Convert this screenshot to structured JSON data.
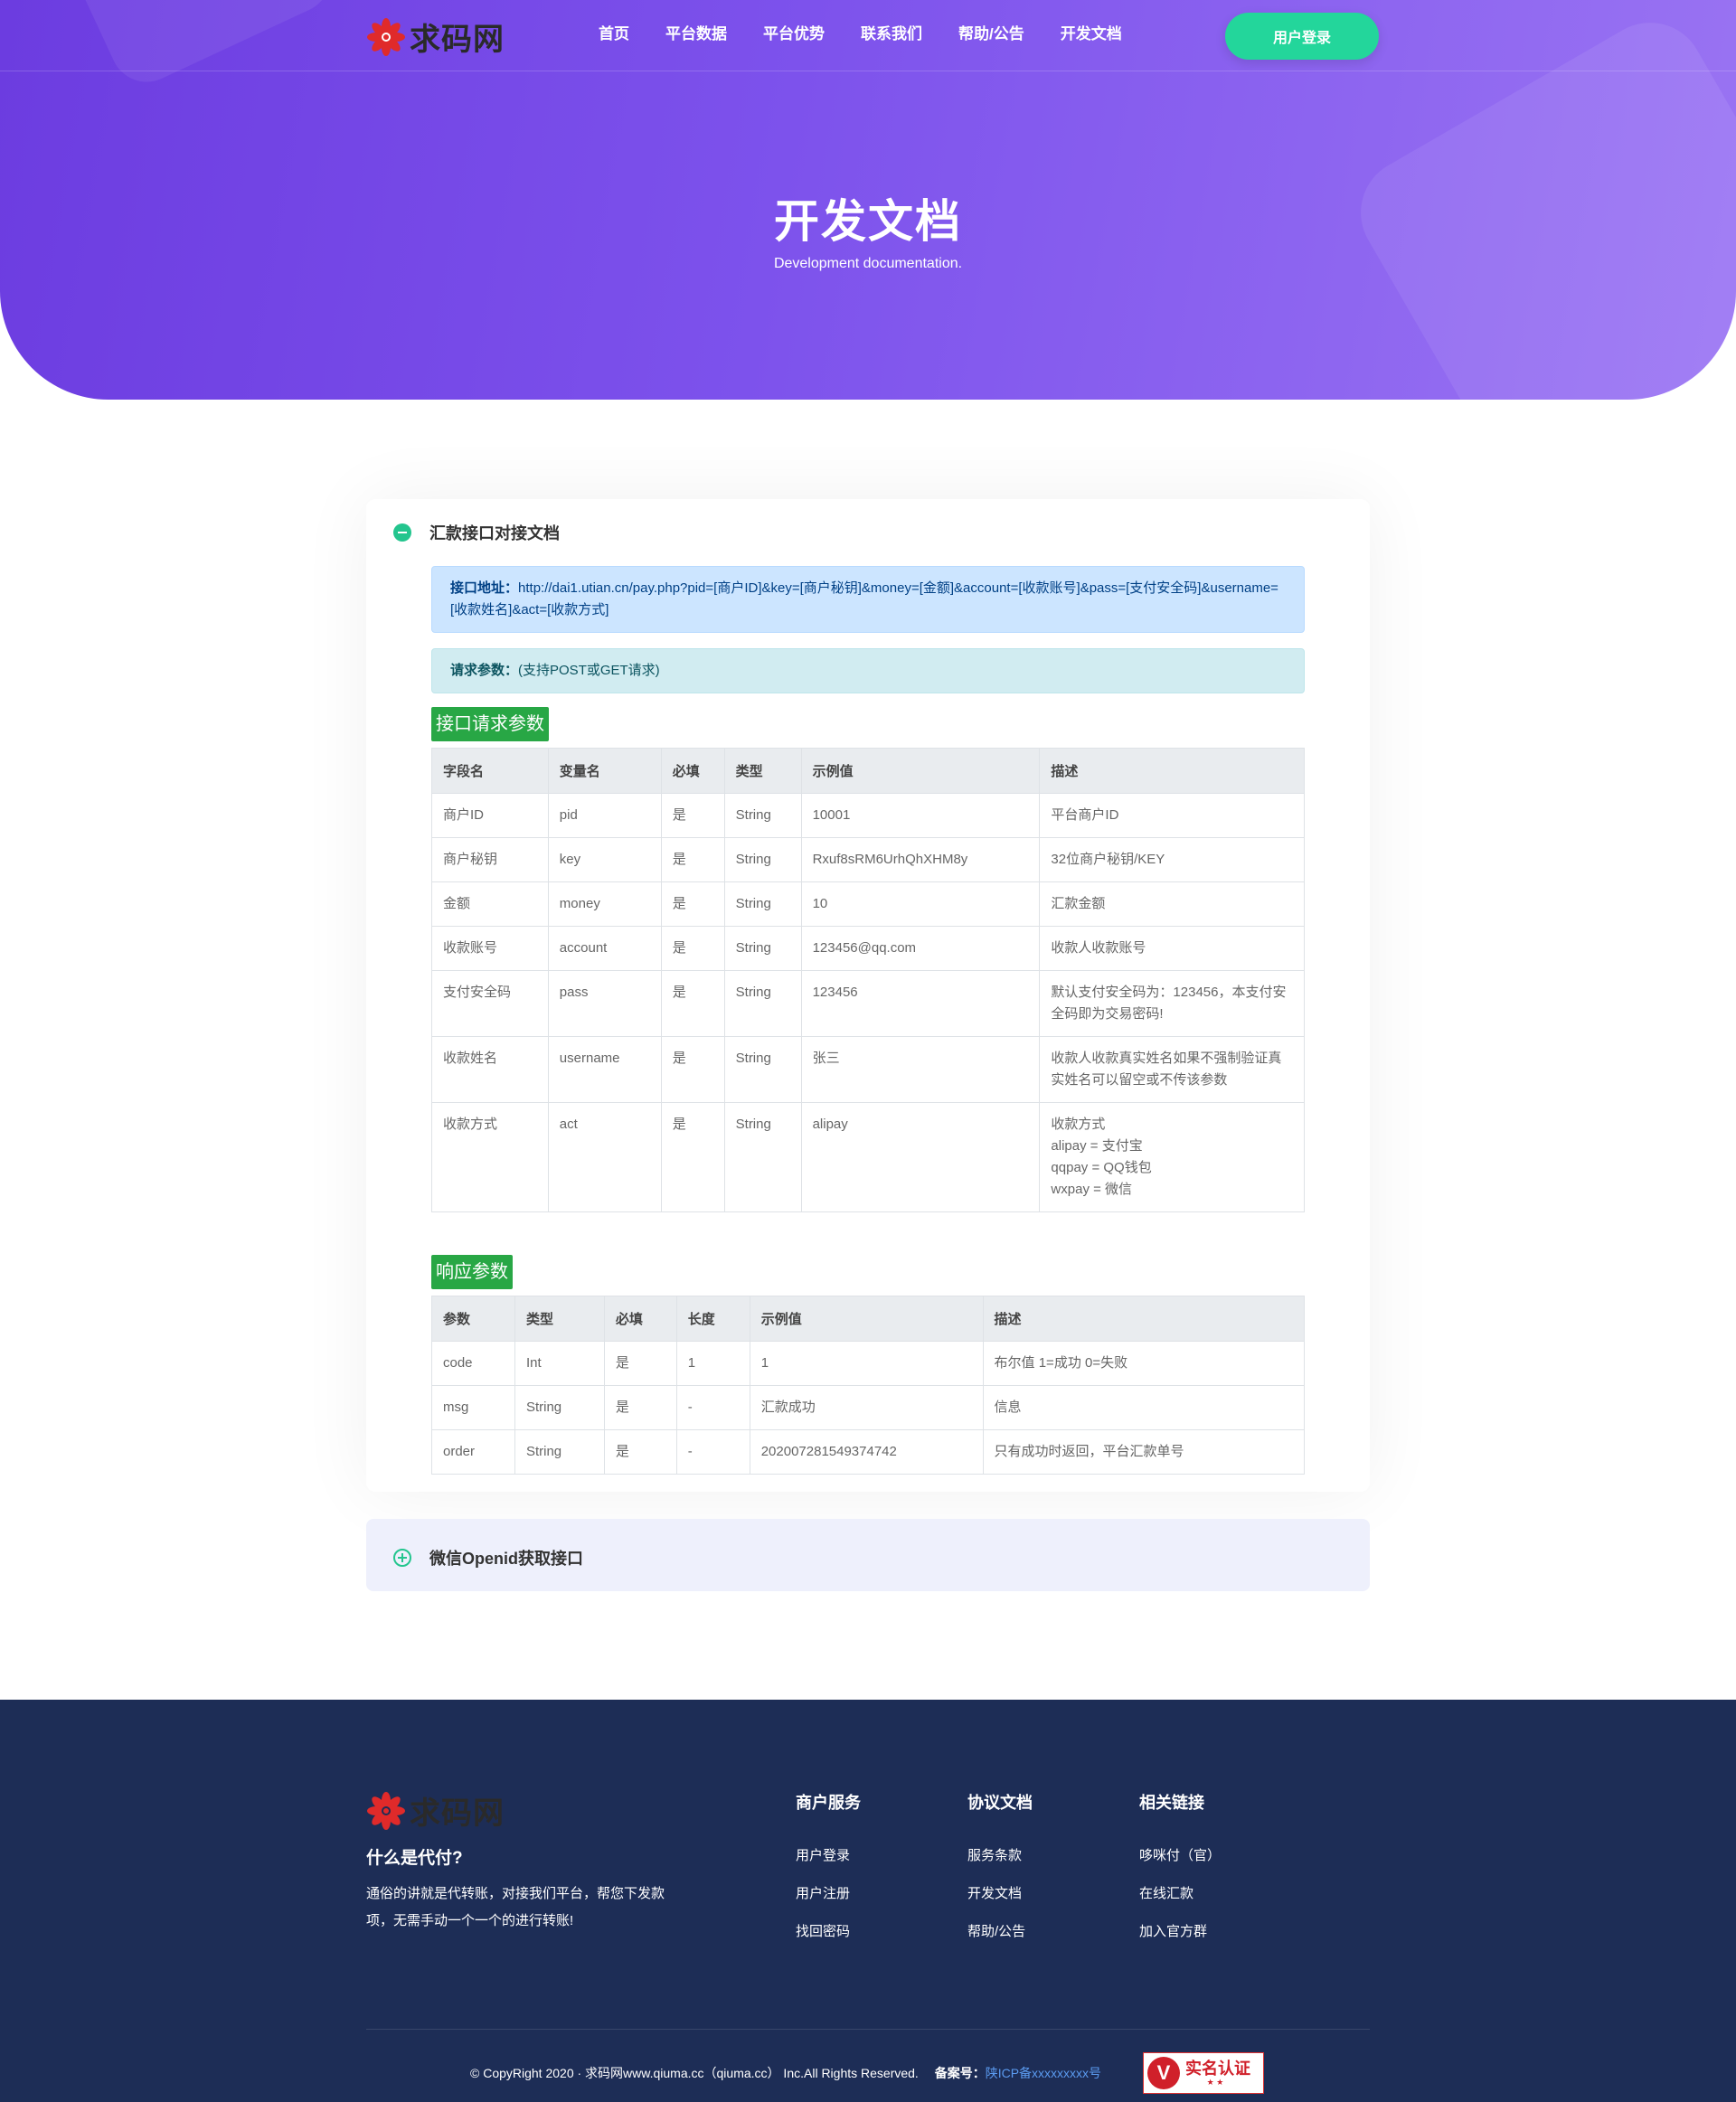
{
  "header": {
    "logo_text": "求码网",
    "nav": [
      "首页",
      "平台数据",
      "平台优势",
      "联系我们",
      "帮助/公告",
      "开发文档"
    ],
    "login_label": "用户登录"
  },
  "hero": {
    "title": "开发文档",
    "subtitle": "Development documentation."
  },
  "doc1": {
    "title": "汇款接口对接文档",
    "endpoint_label": "接口地址：",
    "endpoint_value": "http://dai1.utian.cn/pay.php?pid=[商户ID]&key=[商户秘钥]&money=[金额]&account=[收款账号]&pass=[支付安全码]&username=[收款姓名]&act=[收款方式]",
    "params_label": "请求参数：",
    "params_value": "(支持POST或GET请求)",
    "request_tag": "接口请求参数",
    "request_headers": [
      "字段名",
      "变量名",
      "必填",
      "类型",
      "示例值",
      "描述"
    ],
    "request_rows": [
      [
        "商户ID",
        "pid",
        "是",
        "String",
        "10001",
        "平台商户ID"
      ],
      [
        "商户秘钥",
        "key",
        "是",
        "String",
        "Rxuf8sRM6UrhQhXHM8y",
        "32位商户秘钥/KEY"
      ],
      [
        "金额",
        "money",
        "是",
        "String",
        "10",
        "汇款金额"
      ],
      [
        "收款账号",
        "account",
        "是",
        "String",
        "123456@qq.com",
        "收款人收款账号"
      ],
      [
        "支付安全码",
        "pass",
        "是",
        "String",
        "123456",
        "默认支付安全码为：123456，本支付安全码即为交易密码!"
      ],
      [
        "收款姓名",
        "username",
        "是",
        "String",
        "张三",
        "收款人收款真实姓名如果不强制验证真实姓名可以留空或不传该参数"
      ],
      [
        "收款方式",
        "act",
        "是",
        "String",
        "alipay",
        "收款方式\nalipay = 支付宝\nqqpay = QQ钱包\nwxpay = 微信"
      ]
    ],
    "response_tag": "响应参数",
    "response_headers": [
      "参数",
      "类型",
      "必填",
      "长度",
      "示例值",
      "描述"
    ],
    "response_rows": [
      [
        "code",
        "Int",
        "是",
        "1",
        "1",
        "布尔值 1=成功 0=失败"
      ],
      [
        "msg",
        "String",
        "是",
        "-",
        "汇款成功",
        "信息"
      ],
      [
        "order",
        "String",
        "是",
        "-",
        "202007281549374742",
        "只有成功时返回，平台汇款单号"
      ]
    ]
  },
  "doc2": {
    "title": "微信Openid获取接口"
  },
  "footer": {
    "logo_text": "求码网",
    "what_title": "什么是代付?",
    "what_desc": "通俗的讲就是代转账，对接我们平台，帮您下发款项，无需手动一个一个的进行转账!",
    "columns": [
      {
        "title": "商户服务",
        "links": [
          "用户登录",
          "用户注册",
          "找回密码"
        ]
      },
      {
        "title": "协议文档",
        "links": [
          "服务条款",
          "开发文档",
          "帮助/公告"
        ]
      },
      {
        "title": "相关链接",
        "links": [
          "哆咪付（官）",
          "在线汇款",
          "加入官方群"
        ]
      }
    ],
    "copyright": "© CopyRight 2020 · 求码网www.qiuma.cc（qiuma.cc） Inc.All Rights Reserved.",
    "icp_label": "备案号：",
    "icp_value": "陕ICP备xxxxxxxxx号",
    "badge_text": "实名认证",
    "badge_icon": "v-verified-icon"
  },
  "colors": {
    "hero_gradient_start": "#6c3ce0",
    "hero_gradient_end": "#9a74f3",
    "accent_green": "#23d69b",
    "tag_green": "#28a745",
    "footer_bg": "#1d2d56"
  }
}
